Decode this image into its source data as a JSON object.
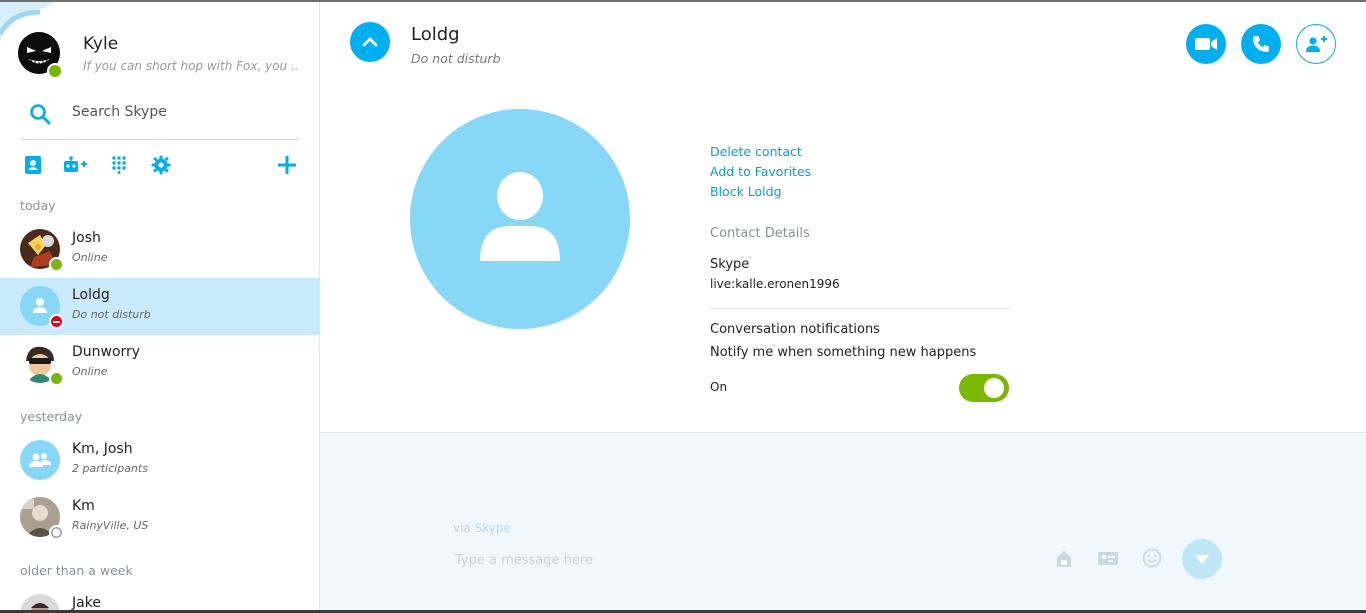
{
  "profile": {
    "name": "Kyle",
    "mood": "If you can short hop with Fox, you ..."
  },
  "search": {
    "placeholder": "Search Skype"
  },
  "toolbar": {
    "icons": [
      "contacts-icon",
      "add-bot-icon",
      "dialpad-icon",
      "settings-icon",
      "add-icon"
    ]
  },
  "groups": {
    "today": "today",
    "yesterday": "yesterday",
    "older": "older than a week"
  },
  "contacts": [
    {
      "name": "Josh",
      "status": "Online",
      "presence": "online"
    },
    {
      "name": "Loldg",
      "status": "Do not disturb",
      "presence": "dnd"
    },
    {
      "name": "Dunworry",
      "status": "Online",
      "presence": "online"
    },
    {
      "name": "Km, Josh",
      "status": "2 participants",
      "presence": "group"
    },
    {
      "name": "Km",
      "status": "RainyVille, US",
      "presence": "offline"
    },
    {
      "name": "Jake",
      "status": "",
      "presence": "unknown"
    }
  ],
  "header": {
    "name": "Loldg",
    "status": "Do not disturb"
  },
  "actions": {
    "delete": "Delete contact",
    "favorite": "Add to Favorites",
    "block": "Block Loldg"
  },
  "details": {
    "title": "Contact Details",
    "skype_label": "Skype",
    "skype_id": "live:kalle.eronen1996",
    "notif_title": "Conversation notifications",
    "notif_desc": "Notify me when something new happens",
    "notif_state": "On"
  },
  "composer": {
    "via": "via",
    "via_service": "Skype",
    "placeholder": "Type a message here"
  },
  "colors": {
    "accent": "#00aff0",
    "selected_row": "#c8eafb",
    "online": "#7ab800",
    "dnd": "#e2001a"
  }
}
